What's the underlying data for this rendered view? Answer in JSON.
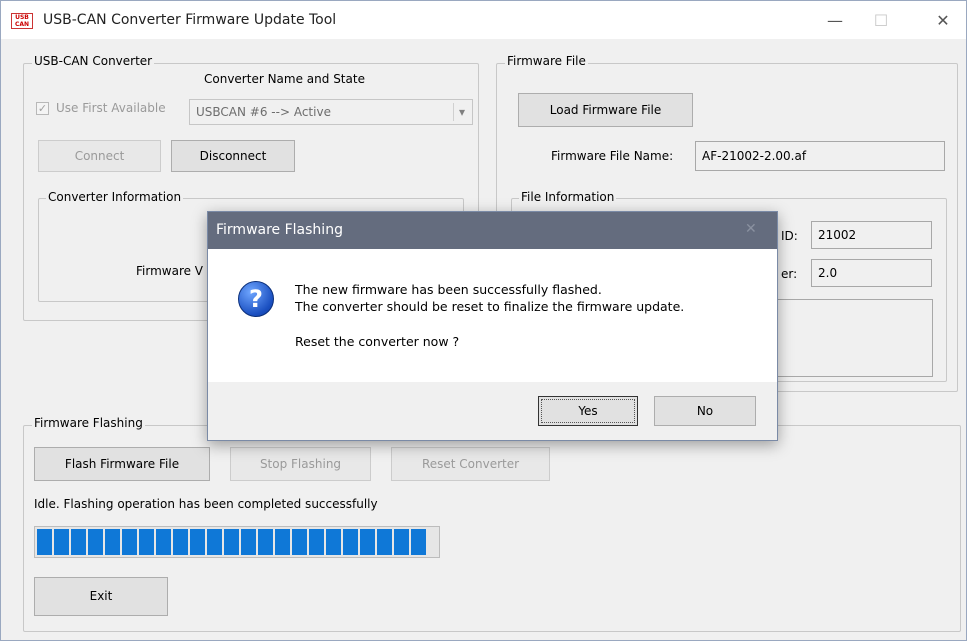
{
  "window": {
    "title": "USB-CAN Converter Firmware Update Tool",
    "icon_text": "USB CAN",
    "minimize_glyph": "—",
    "maximize_glyph": "☐",
    "close_glyph": "✕"
  },
  "converter_group": {
    "title": "USB-CAN Converter",
    "name_state_label": "Converter Name and State",
    "use_first_label": "Use First Available",
    "use_first_checked": true,
    "selected_converter": "USBCAN #6  --> Active",
    "dropdown_glyph": "▾",
    "connect_label": "Connect",
    "disconnect_label": "Disconnect",
    "info_title": "Converter Information",
    "firmware_version_label": "Firmware V"
  },
  "firmware_file_group": {
    "title": "Firmware File",
    "load_label": "Load Firmware File",
    "file_name_label": "Firmware File Name:",
    "file_name_value": "AF-21002-2.00.af",
    "file_info_title": "File Information",
    "id_label": "ID:",
    "id_value": "21002",
    "version_label": "er:",
    "version_value": "2.0"
  },
  "flashing_group": {
    "title": "Firmware Flashing",
    "flash_label": "Flash Firmware File",
    "stop_label": "Stop Flashing",
    "reset_label": "Reset Converter",
    "status_text": "Idle. Flashing operation has been completed successfully",
    "progress_percent": 100,
    "exit_label": "Exit"
  },
  "dialog": {
    "title": "Firmware Flashing",
    "close_glyph": "✕",
    "icon": "question-icon",
    "line1": "The new firmware has been successfully flashed.",
    "line2": "The converter should be reset to finalize the firmware update.",
    "line3": "Reset the converter now ?",
    "yes_label": "Yes",
    "no_label": "No"
  },
  "colors": {
    "progress_fill": "#0f78d7",
    "dialog_title_bg": "#646c7e",
    "window_bg": "#f0f0f0"
  }
}
